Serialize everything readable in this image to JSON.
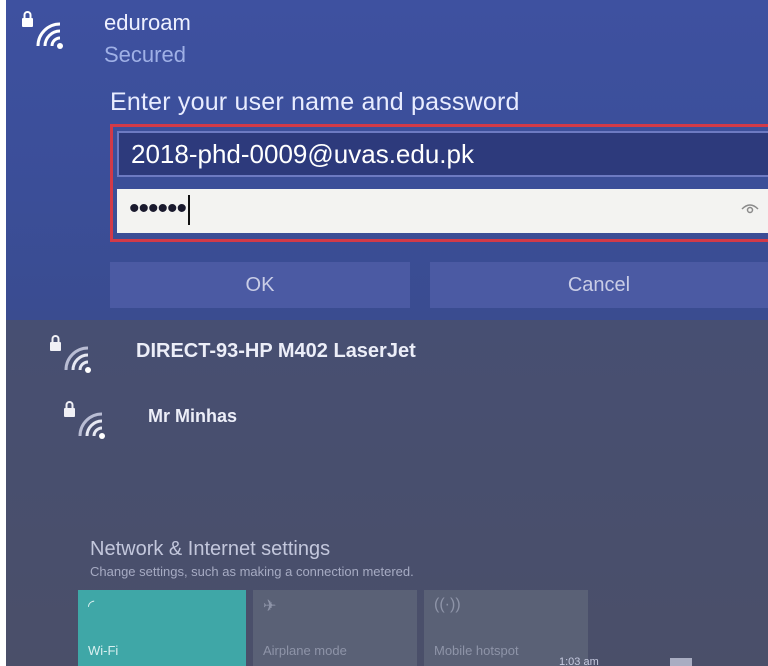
{
  "selected_network": {
    "name": "eduroam",
    "status": "Secured",
    "icon": "wifi-secured-icon"
  },
  "credentials": {
    "prompt": "Enter your user name and password",
    "username_value": "2018-phd-0009@uvas.edu.pk",
    "password_mask": "••••••",
    "reveal_icon": "eye-icon"
  },
  "buttons": {
    "ok": "OK",
    "cancel": "Cancel"
  },
  "networks": [
    {
      "name": "DIRECT-93-HP M402 LaserJet",
      "icon": "wifi-secured-icon"
    },
    {
      "name": "Mr Minhas",
      "icon": "wifi-secured-icon"
    }
  ],
  "settings": {
    "title": "Network & Internet settings",
    "subtitle": "Change settings, such as making a connection metered."
  },
  "quick_actions": [
    {
      "label": "Wi-Fi",
      "icon": "wifi-icon",
      "active": true
    },
    {
      "label": "Airplane mode",
      "icon": "airplane-icon",
      "active": false
    },
    {
      "label": "Mobile hotspot",
      "icon": "hotspot-icon",
      "active": false
    }
  ],
  "taskbar": {
    "time": "1:03 am"
  },
  "colors": {
    "accent": "#3fa7a7",
    "highlight_border": "#d23a48",
    "panel_blue": "#3e51a0"
  }
}
